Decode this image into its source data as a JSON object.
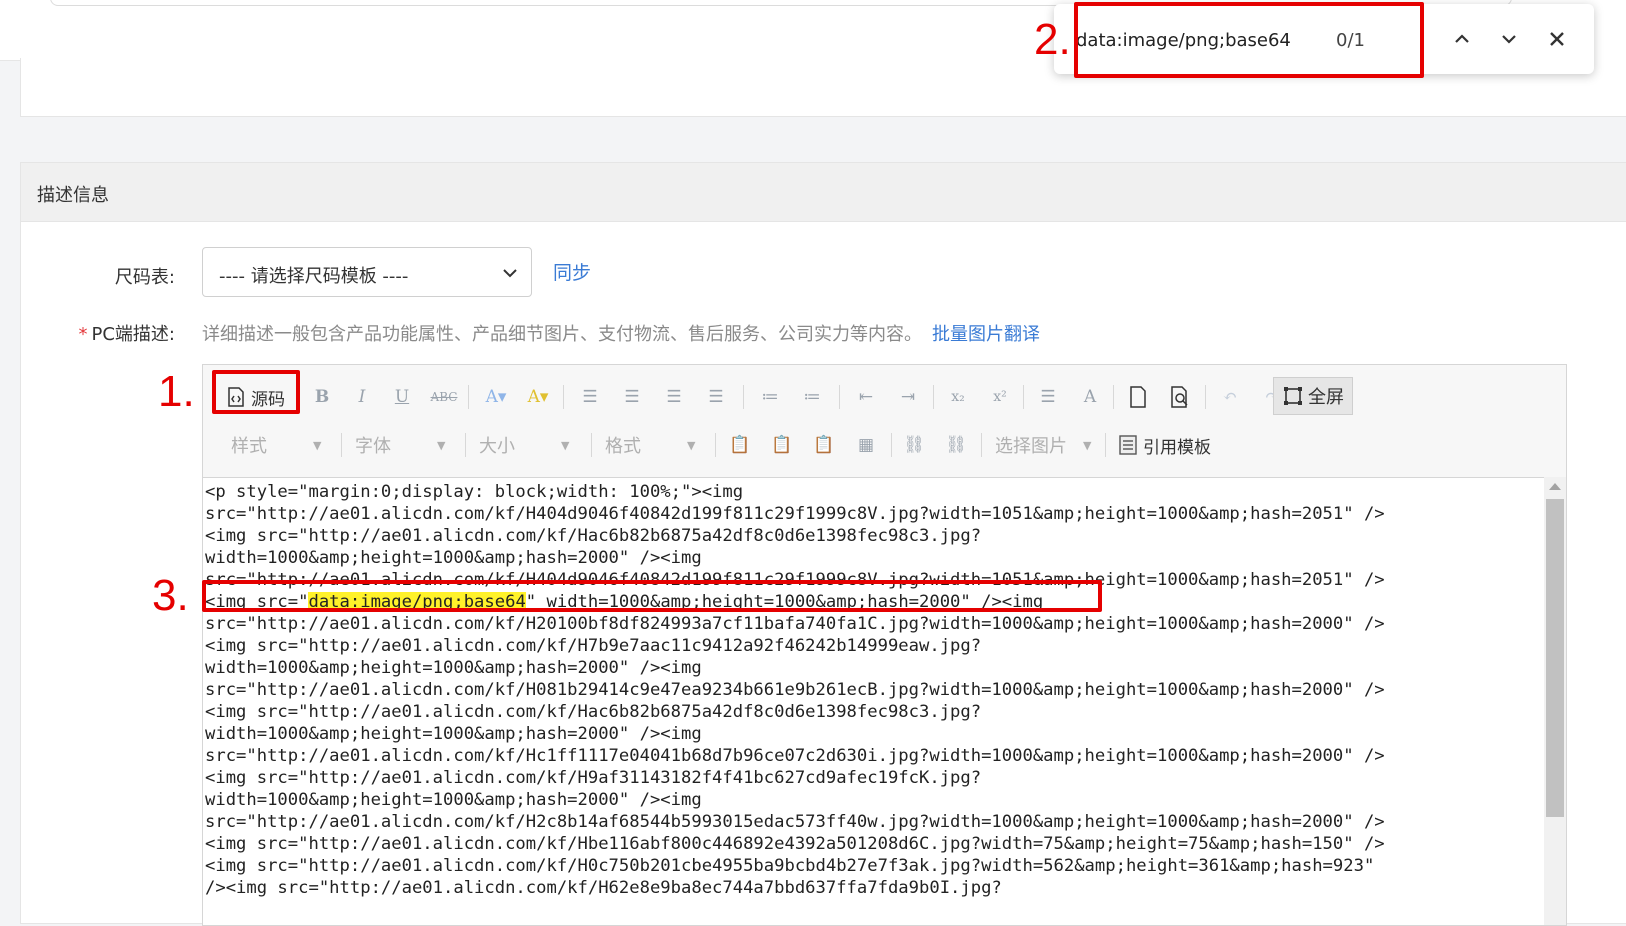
{
  "find_bar": {
    "query": "data:image/png;base64",
    "count": "0/1",
    "prev_icon": "chevron-up-icon",
    "next_icon": "chevron-down-icon",
    "close_icon": "close-icon"
  },
  "section": {
    "title": "描述信息"
  },
  "size_table": {
    "label": "尺码表:",
    "select_value": "---- 请选择尺码模板 ----",
    "sync_link": "同步"
  },
  "pc_description": {
    "required_mark": "*",
    "label": "PC端描述:",
    "hint": "详细描述一般包含产品功能属性、产品细节图片、支付物流、售后服务、公司实力等内容。",
    "link": "批量图片翻译"
  },
  "toolbar": {
    "source_label": "源码",
    "fullscreen_label": "全屏",
    "style_dropdown": "样式",
    "font_dropdown": "字体",
    "size_dropdown": "大小",
    "format_dropdown": "格式",
    "select_image_dropdown": "选择图片",
    "template_label": "引用模板"
  },
  "code_lines": [
    "<p style=\"margin:0;display: block;width: 100%;\"><img",
    "src=\"http://ae01.alicdn.com/kf/H404d9046f40842d199f811c29f1999c8V.jpg?width=1051&amp;height=1000&amp;hash=2051\" />",
    "<img src=\"http://ae01.alicdn.com/kf/Hac6b82b6875a42df8c0d6e1398fec98c3.jpg?",
    "width=1000&amp;height=1000&amp;hash=2000\" /><img",
    "src=\"http://ae01.alicdn.com/kf/H404d9046f40842d199f811c29f1999c8V.jpg?width=1051&amp;height=1000&amp;hash=2051\" />",
    "<img src=\"",
    "data:image/png;base64",
    "\" width=1000&amp;height=1000&amp;hash=2000\" /><img",
    "src=\"http://ae01.alicdn.com/kf/H20100bf8df824993a7cf11bafa740fa1C.jpg?width=1000&amp;height=1000&amp;hash=2000\" />",
    "<img src=\"http://ae01.alicdn.com/kf/H7b9e7aac11c9412a92f46242b14999eaw.jpg?",
    "width=1000&amp;height=1000&amp;hash=2000\" /><img",
    "src=\"http://ae01.alicdn.com/kf/H081b29414c9e47ea9234b661e9b261ecB.jpg?width=1000&amp;height=1000&amp;hash=2000\" />",
    "<img src=\"http://ae01.alicdn.com/kf/Hac6b82b6875a42df8c0d6e1398fec98c3.jpg?",
    "width=1000&amp;height=1000&amp;hash=2000\" /><img",
    "src=\"http://ae01.alicdn.com/kf/Hc1ff1117e04041b68d7b96ce07c2d630i.jpg?width=1000&amp;height=1000&amp;hash=2000\" />",
    "<img src=\"http://ae01.alicdn.com/kf/H9af31143182f4f41bc627cd9afec19fcK.jpg?",
    "width=1000&amp;height=1000&amp;hash=2000\" /><img",
    "src=\"http://ae01.alicdn.com/kf/H2c8b14af68544b5993015edac573ff40w.jpg?width=1000&amp;height=1000&amp;hash=2000\" />",
    "<img src=\"http://ae01.alicdn.com/kf/Hbe116abf800c446892e4392a501208d6C.jpg?width=75&amp;height=75&amp;hash=150\" />",
    "<img src=\"http://ae01.alicdn.com/kf/H0c750b201cbe4955ba9bcbd4b27e7f3ak.jpg?width=562&amp;height=361&amp;hash=923\"",
    "/><img src=\"http://ae01.alicdn.com/kf/H62e8e9ba8ec744a7bbd637ffa7fda9b0I.jpg?"
  ],
  "annotations": {
    "step1": "1.",
    "step2": "2.",
    "step3": "3."
  },
  "colors": {
    "annotation_red": "#e50000",
    "highlight_yellow": "#fff22a",
    "link_blue": "#3a7bd5"
  }
}
